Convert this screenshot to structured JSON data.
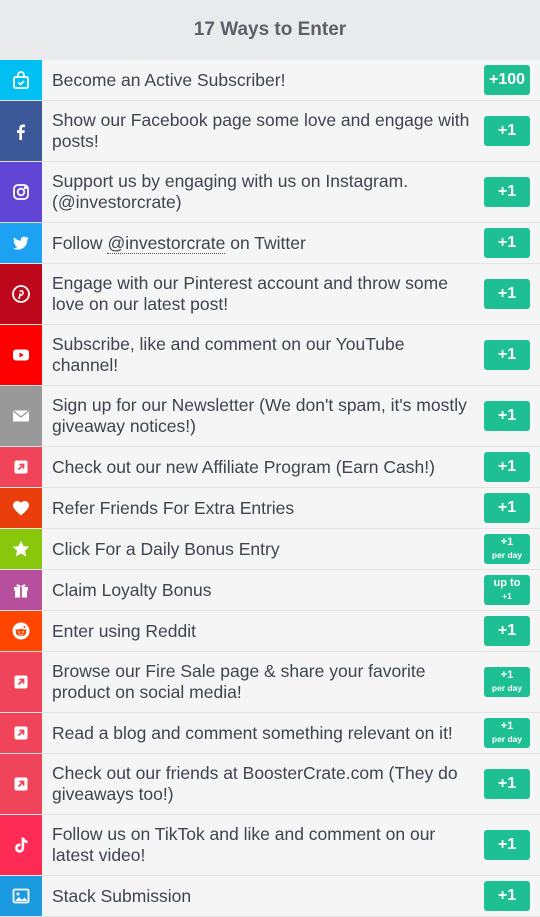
{
  "header": {
    "title": "17 Ways to Enter"
  },
  "entries": [
    {
      "icon": "subscriber-bag-icon",
      "color": "#00c0f3",
      "text": "Become an Active Subscriber!",
      "badge": "+100"
    },
    {
      "icon": "facebook-icon",
      "color": "#3b5998",
      "text": "Show our Facebook page some love and engage with posts!",
      "badge": "+1"
    },
    {
      "icon": "instagram-icon",
      "color": "#6146d6",
      "text": "Support us by engaging with us on Instagram. (@investorcrate)",
      "badge": "+1"
    },
    {
      "icon": "twitter-icon",
      "color": "#1da1f2",
      "text_before": "Follow ",
      "mention": "@investorcrate",
      "text_after": " on Twitter",
      "badge": "+1"
    },
    {
      "icon": "pinterest-icon",
      "color": "#bd081c",
      "text": "Engage with our Pinterest account and throw some love on our latest post!",
      "badge": "+1"
    },
    {
      "icon": "youtube-icon",
      "color": "#ff0000",
      "text": "Subscribe, like and comment on our YouTube channel!",
      "badge": "+1"
    },
    {
      "icon": "envelope-icon",
      "color": "#999999",
      "text": "Sign up for our Newsletter (We don't spam, it's mostly giveaway notices!)",
      "badge": "+1"
    },
    {
      "icon": "external-link-icon",
      "color": "#f0445a",
      "text": "Check out our new Affiliate Program (Earn Cash!)",
      "badge": "+1"
    },
    {
      "icon": "heart-icon",
      "color": "#ea3e0c",
      "text": "Refer Friends For Extra Entries",
      "badge": "+1"
    },
    {
      "icon": "star-icon",
      "color": "#88c70c",
      "text": "Click For a Daily Bonus Entry",
      "badge_line1": "+1",
      "badge_line2": "per day"
    },
    {
      "icon": "gift-icon",
      "color": "#b6509c",
      "text": "Claim Loyalty Bonus",
      "badge_line1": "up to",
      "badge_line2": "+1"
    },
    {
      "icon": "reddit-icon",
      "color": "#ff4500",
      "text": "Enter using Reddit",
      "badge": "+1"
    },
    {
      "icon": "external-link-icon",
      "color": "#f0445a",
      "text": "Browse our Fire Sale page & share your favorite product on social media!",
      "badge_line1": "+1",
      "badge_line2": "per day"
    },
    {
      "icon": "external-link-icon",
      "color": "#f0445a",
      "text": "Read a blog and comment something relevant on it!",
      "badge_line1": "+1",
      "badge_line2": "per day"
    },
    {
      "icon": "external-link-icon",
      "color": "#f0445a",
      "text": "Check out our friends at BoosterCrate.com (They do giveaways too!)",
      "badge": "+1"
    },
    {
      "icon": "tiktok-icon",
      "color": "#fe2c55",
      "text": "Follow us on TikTok and like and comment on our latest video!",
      "badge": "+1"
    },
    {
      "icon": "image-icon",
      "color": "#1b9ae0",
      "text": "Stack Submission",
      "badge": "+1"
    }
  ]
}
